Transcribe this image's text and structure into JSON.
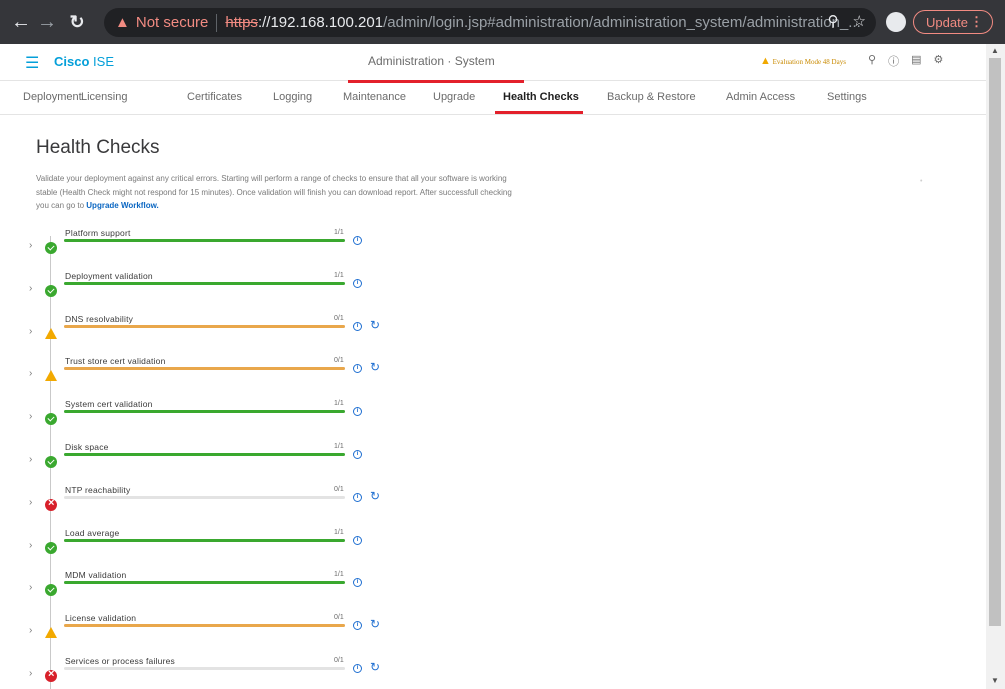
{
  "browser": {
    "not_secure": "Not secure",
    "url_scheme": "https",
    "url_host": "://192.168.100.201",
    "url_rest": "/admin/login.jsp#administration/administration_system/administration_...",
    "update_label": "Update"
  },
  "app": {
    "brand_bold": "Cisco",
    "brand_product": "ISE",
    "breadcrumb": "Administration · System",
    "evaluation": "Evaluation Mode 48 Days"
  },
  "tabs": [
    {
      "label": "Deployment",
      "active": false
    },
    {
      "label": "Licensing",
      "active": false
    },
    {
      "label": "Certificates",
      "active": false
    },
    {
      "label": "Logging",
      "active": false
    },
    {
      "label": "Maintenance",
      "active": false
    },
    {
      "label": "Upgrade",
      "active": false
    },
    {
      "label": "Health Checks",
      "active": true
    },
    {
      "label": "Backup & Restore",
      "active": false
    },
    {
      "label": "Admin Access",
      "active": false
    },
    {
      "label": "Settings",
      "active": false
    }
  ],
  "main": {
    "title": "Health Checks",
    "description": "Validate your deployment against any critical errors. Starting will perform a range of checks to ensure that all your software is working stable (Health Check might not respond for 15 minutes). Once validation will finish you can download report. After successfull checking you can go to",
    "link": "Upgrade Workflow."
  },
  "checks": [
    {
      "name": "Platform support",
      "count": "1/1",
      "status": "ok",
      "progress": 1.0
    },
    {
      "name": "Deployment validation",
      "count": "1/1",
      "status": "ok",
      "progress": 1.0
    },
    {
      "name": "DNS resolvability",
      "count": "0/1",
      "status": "warn",
      "progress": 1.0
    },
    {
      "name": "Trust store cert validation",
      "count": "0/1",
      "status": "warn",
      "progress": 1.0
    },
    {
      "name": "System cert validation",
      "count": "1/1",
      "status": "ok",
      "progress": 1.0
    },
    {
      "name": "Disk space",
      "count": "1/1",
      "status": "ok",
      "progress": 1.0
    },
    {
      "name": "NTP reachability",
      "count": "0/1",
      "status": "fail",
      "progress": 0.0
    },
    {
      "name": "Load average",
      "count": "1/1",
      "status": "ok",
      "progress": 1.0
    },
    {
      "name": "MDM validation",
      "count": "1/1",
      "status": "ok",
      "progress": 1.0
    },
    {
      "name": "License validation",
      "count": "0/1",
      "status": "warn",
      "progress": 1.0
    },
    {
      "name": "Services or process failures",
      "count": "0/1",
      "status": "fail",
      "progress": 0.0
    }
  ],
  "colors": {
    "ok": "#3aa82f",
    "warn": "#f2a900",
    "fail": "#d8202a",
    "accent": "#e3202b",
    "brand": "#049fd9"
  }
}
